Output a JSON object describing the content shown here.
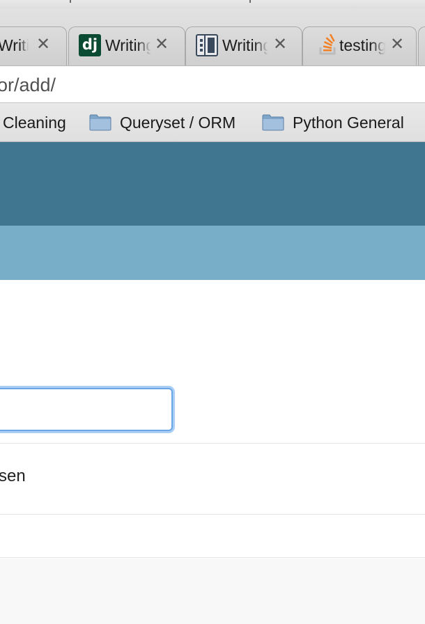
{
  "tabs": [
    {
      "title": "Writing",
      "favicon": "page-icon",
      "close": "✕"
    },
    {
      "title": "Writing",
      "favicon": "django-icon",
      "favicon_text": "dj",
      "close": "✕"
    },
    {
      "title": "Writing",
      "favicon": "document-icon",
      "close": "✕"
    },
    {
      "title": "testing",
      "favicon": "stackoverflow-icon",
      "close": "✕"
    }
  ],
  "address": {
    "url": "or/add/"
  },
  "bookmarks": [
    {
      "label": "Cleaning",
      "icon": "folder-icon"
    },
    {
      "label": "Queryset / ORM",
      "icon": "folder-icon"
    },
    {
      "label": "Python General",
      "icon": "folder-icon"
    }
  ],
  "colors": {
    "header_dark": "#417690",
    "header_light": "#79aec8",
    "focus_ring": "#6aa7e6",
    "stackoverflow_orange": "#f48024"
  },
  "form": {
    "input_value": "",
    "row_text": "sen"
  }
}
